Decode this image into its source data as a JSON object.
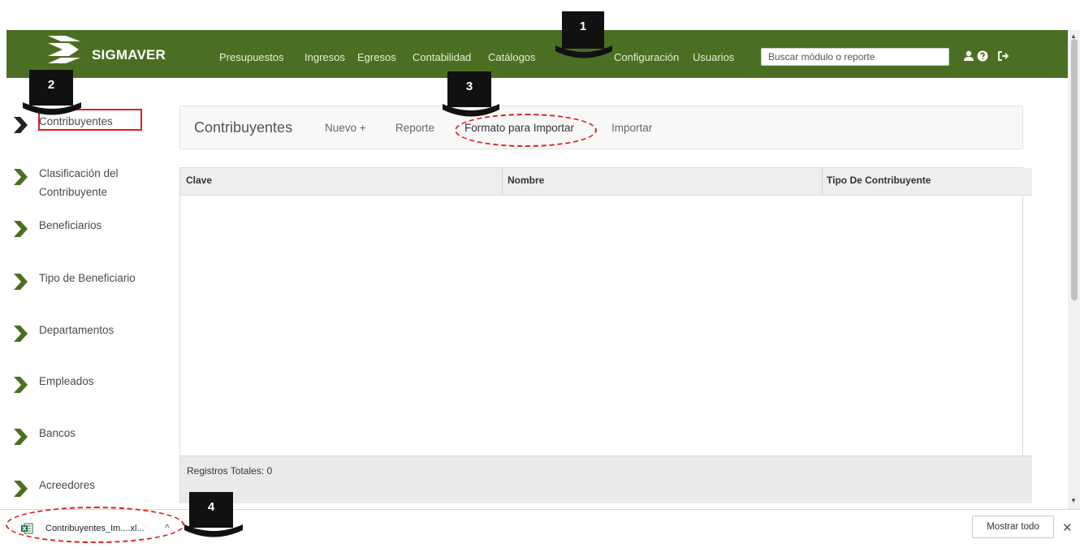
{
  "app": {
    "brand": "SIGMAVER",
    "nav": [
      "Presupuestos",
      "Ingresos",
      "Egresos",
      "Contabilidad",
      "Catálogos",
      "Configuración",
      "Usuarios"
    ],
    "search_placeholder": "Buscar módulo o reporte",
    "header_icons": [
      "user-icon",
      "help-icon",
      "logout-icon"
    ],
    "accent_color": "#4b6f22"
  },
  "sidebar": {
    "items": [
      {
        "label": "Contribuyentes",
        "active": true
      },
      {
        "label": "Clasificación del Contribuyente"
      },
      {
        "label": "Beneficiarios"
      },
      {
        "label": "Tipo de Beneficiario"
      },
      {
        "label": "Departamentos"
      },
      {
        "label": "Empleados"
      },
      {
        "label": "Bancos"
      },
      {
        "label": "Acreedores"
      }
    ]
  },
  "toolbar": {
    "title": "Contribuyentes",
    "actions": [
      "Nuevo +",
      "Reporte",
      "Formato para Importar",
      "Importar"
    ]
  },
  "table": {
    "columns": [
      "Clave",
      "Nombre",
      "Tipo De Contribuyente"
    ],
    "rows": [],
    "footer": "Registros Totales: 0"
  },
  "downloads": {
    "file_name": "Contribuyentes_Im....xl...",
    "file_icon": "excel-file-icon",
    "show_all": "Mostrar todo"
  },
  "callouts": [
    "1",
    "2",
    "3",
    "4"
  ],
  "highlight_color": "#e0201f"
}
